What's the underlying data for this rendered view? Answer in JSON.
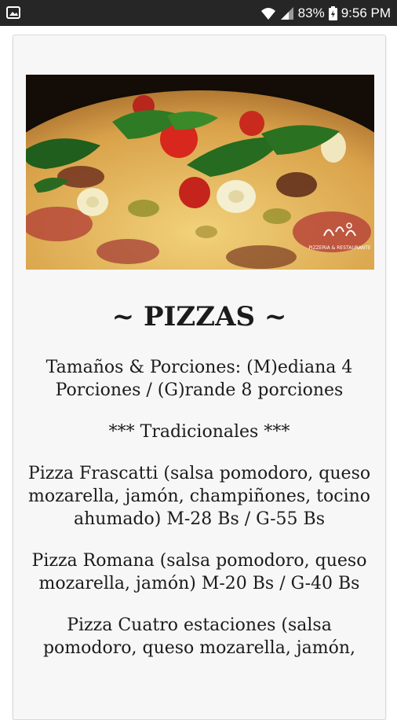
{
  "status_bar": {
    "battery": "83%",
    "time": "9:56 PM"
  },
  "hero": {
    "logo_text": "PIZZERIA & RESTAURANTE"
  },
  "menu": {
    "title": "~ PIZZAS ~",
    "sizes": "Tamaños & Porciones: (M)ediana 4 Porciones / (G)rande 8 porciones",
    "section": "*** Tradicionales ***",
    "items": [
      "Pizza Frascatti (salsa pomodoro, queso mozarella, jamón, champiñones, tocino ahumado) M-28 Bs / G-55 Bs",
      "Pizza Romana (salsa pomodoro, queso mozarella, jamón) M-20 Bs / G-40 Bs",
      "Pizza Cuatro estaciones (salsa pomodoro, queso mozarella, jamón,"
    ]
  }
}
